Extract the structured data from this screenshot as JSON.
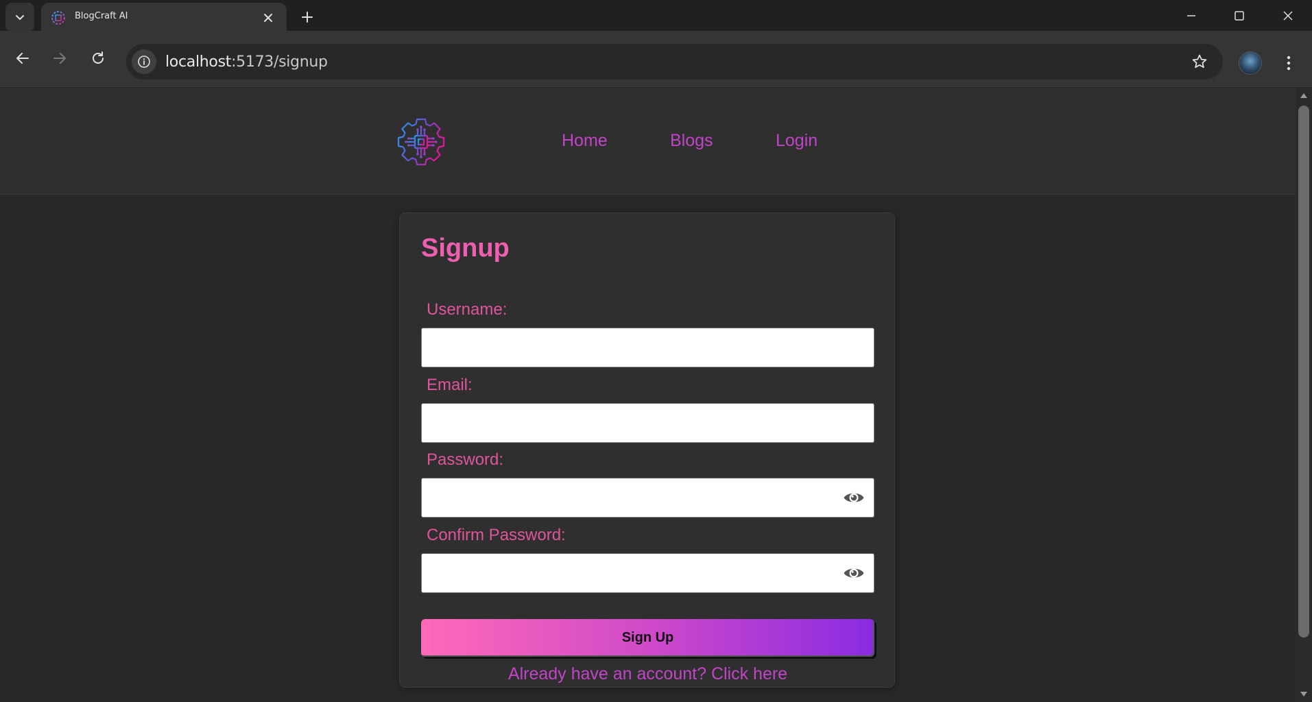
{
  "browser": {
    "tab_title": "BlogCraft AI",
    "url_host": "localhost",
    "url_path": ":5173/signup",
    "icons": {
      "tab_search": "chevron-down-icon",
      "tab_close": "close-icon",
      "new_tab": "plus-icon",
      "minimize": "minimize-icon",
      "maximize": "maximize-icon",
      "window_close": "close-icon",
      "back": "arrow-left-icon",
      "forward": "arrow-right-icon",
      "reload": "reload-icon",
      "site_info": "info-icon",
      "bookmark": "star-icon",
      "profile": "avatar",
      "menu": "more-vertical-icon"
    }
  },
  "nav": {
    "links": [
      "Home",
      "Blogs",
      "Login"
    ]
  },
  "signup": {
    "title": "Signup",
    "username_label": "Username:",
    "email_label": "Email:",
    "password_label": "Password:",
    "confirm_label": "Confirm Password:",
    "submit_label": "Sign Up",
    "footer_text": "Already have an account? Click here"
  },
  "colors": {
    "accent": "#c244c8",
    "heading": "#ef5fb0",
    "label": "#e0559a",
    "gradient_start": "#ff6ab8",
    "gradient_end": "#8a2be2",
    "page_bg": "#282828",
    "panel_bg": "#2f2f2f"
  }
}
